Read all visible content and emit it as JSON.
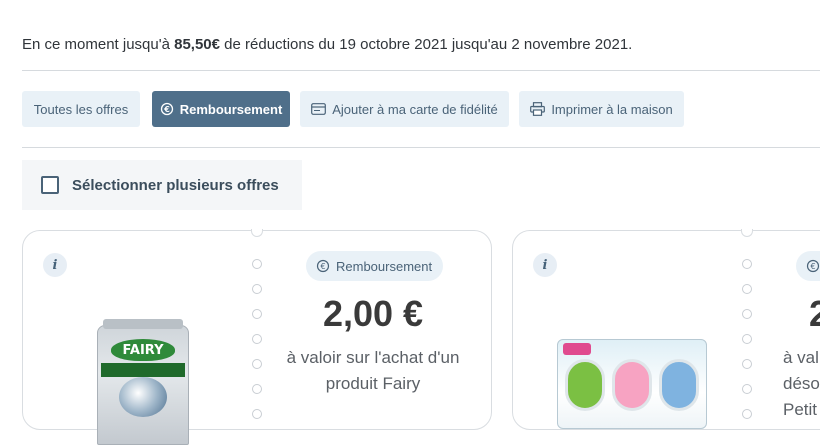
{
  "summary": {
    "prefix": "En ce moment jusqu'à ",
    "amount": "85,50€",
    "suffix": " de réductions du 19 octobre 2021 jusqu'au 2 novembre 2021."
  },
  "filters": [
    {
      "label": "Toutes les offres",
      "icon": "none",
      "active": false
    },
    {
      "label": "Remboursement",
      "icon": "refund-icon",
      "active": true
    },
    {
      "label": "Ajouter à ma carte de fidélité",
      "icon": "loyalty-card-icon",
      "active": false
    },
    {
      "label": "Imprimer à la maison",
      "icon": "printer-icon",
      "active": false
    }
  ],
  "multi_select": {
    "label": "Sélectionner plusieurs offres",
    "checked": false
  },
  "offers": [
    {
      "info": "i",
      "badge": "Remboursement",
      "amount": "2,00 €",
      "desc_line1": "à valoir sur l'achat d'un",
      "desc_line2": "produit Fairy",
      "product": "fairy-product-image",
      "product_text": "FAIRY"
    },
    {
      "info": "i",
      "badge": "",
      "amount": "2",
      "desc_line1": "à val",
      "desc_line2": "désod",
      "desc_line3": "Petit",
      "product": "febreze-product-image"
    }
  ],
  "colors": {
    "accent": "#4f6f8a",
    "chip_bg": "#e9f1f7",
    "chip_text": "#4a6378",
    "divider": "#d6dade"
  }
}
